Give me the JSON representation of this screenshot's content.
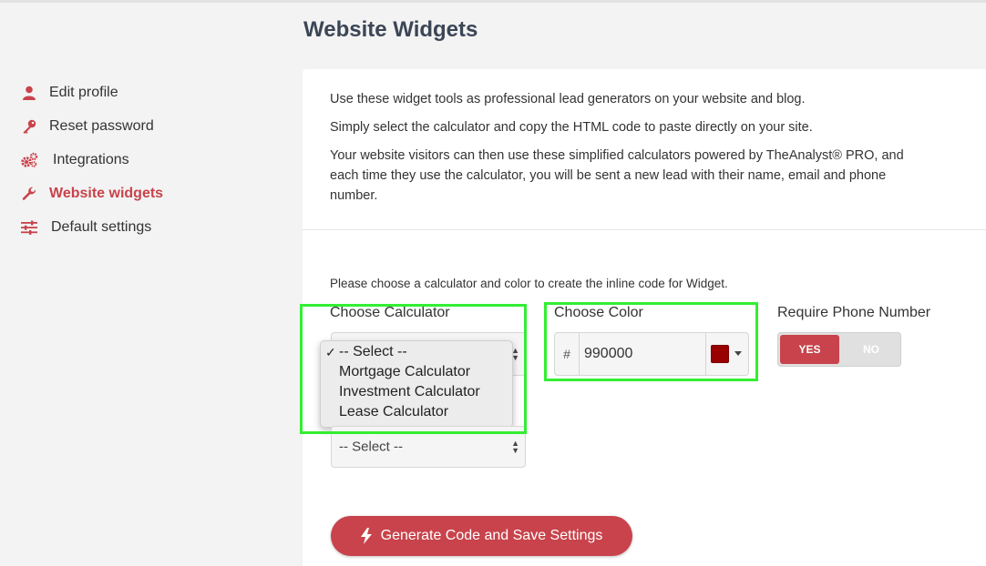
{
  "page": {
    "title": "Website Widgets"
  },
  "sidebar": {
    "items": [
      {
        "label": "Edit profile",
        "icon": "user-icon"
      },
      {
        "label": "Reset password",
        "icon": "key-icon"
      },
      {
        "label": "Integrations",
        "icon": "gears-icon"
      },
      {
        "label": "Website widgets",
        "icon": "wrench-icon",
        "active": true
      },
      {
        "label": "Default settings",
        "icon": "sliders-icon"
      }
    ]
  },
  "intro": {
    "p1": "Use these widget tools as professional lead generators on your website and blog.",
    "p2": "Simply select the calculator and copy the HTML code to paste directly on your site.",
    "p3": "Your website visitors can then use these simplified calculators powered by TheAnalyst® PRO, and each time they use the calculator, you will be sent a new lead with their name, email and phone number."
  },
  "form": {
    "instruction": "Please choose a calculator and color to create the inline code for Widget.",
    "calculator_label": "Choose Calculator",
    "calculator_options": [
      "-- Select --",
      "Mortgage Calculator",
      "Investment Calculator",
      "Lease Calculator"
    ],
    "calculator_checkmark": "✓",
    "second_select_value": "-- Select --",
    "color_label": "Choose Color",
    "color_prefix": "#",
    "color_value": "990000",
    "phone_label": "Require Phone Number",
    "phone_yes": "YES",
    "phone_no": "NO",
    "generate_button": "Generate Code and Save Settings"
  },
  "colors": {
    "accent": "#c8434b",
    "swatch": "#990000",
    "highlight": "#33ee33"
  }
}
